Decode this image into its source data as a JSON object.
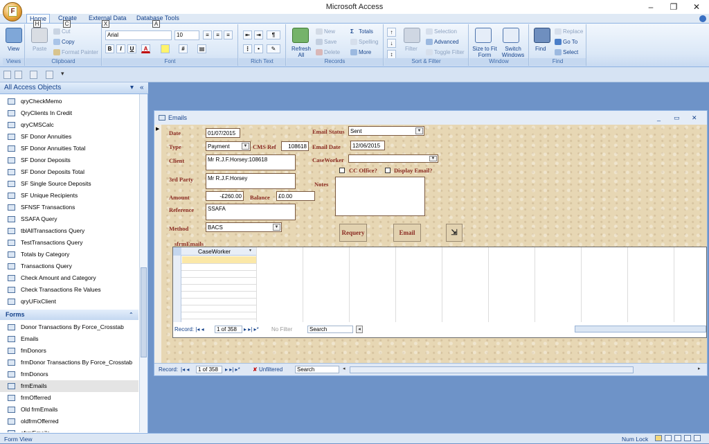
{
  "window": {
    "title": "Microsoft Access",
    "minimize": "–",
    "restore": "❐",
    "close": "✕"
  },
  "tabs": [
    {
      "label": "Home",
      "key": "H"
    },
    {
      "label": "Create",
      "key": "C"
    },
    {
      "label": "External Data",
      "key": "X"
    },
    {
      "label": "Database Tools",
      "key": "A"
    }
  ],
  "ribbon": {
    "views": {
      "view": "View",
      "group": "Views"
    },
    "clipboard": {
      "paste": "Paste",
      "cut": "Cut",
      "copy": "Copy",
      "format_painter": "Format Painter",
      "group": "Clipboard"
    },
    "font": {
      "name": "Arial",
      "size": "10",
      "bold": "B",
      "italic": "I",
      "underline": "U",
      "font_color": "A",
      "group": "Font"
    },
    "rich_text": {
      "group": "Rich Text"
    },
    "records": {
      "refresh": "Refresh All",
      "new": "New",
      "save": "Save",
      "delete": "Delete",
      "totals": "Totals",
      "spelling": "Spelling",
      "more": "More",
      "group": "Records"
    },
    "sort_filter": {
      "filter": "Filter",
      "selection": "Selection",
      "advanced": "Advanced",
      "toggle_filter": "Toggle Filter",
      "group": "Sort & Filter"
    },
    "window": {
      "size_to_fit": "Size to Fit Form",
      "switch_windows": "Switch Windows",
      "group": "Window"
    },
    "find": {
      "find": "Find",
      "replace": "Replace",
      "goto": "Go To",
      "select": "Select",
      "group": "Find"
    }
  },
  "nav": {
    "header": "All Access Objects",
    "queries": [
      "qryCheckMemo",
      "QryClients In Credit",
      "qryCMSCalc",
      "SF Donor Annuities",
      "SF Donor Annuities Total",
      "SF Donor Deposits",
      "SF Donor Deposits Total",
      "SF Single Source Deposits",
      "SF Unique Recipients",
      "SFNSF Transactions",
      "SSAFA Query",
      "tblAllTransactions Query",
      "TestTransactions Query",
      "Totals by Category",
      "Transactions Query",
      "Check Amount and Category",
      "Check Transactions Re Values",
      "qryUFixClient"
    ],
    "forms_header": "Forms",
    "forms": [
      "Donor Transactions By Force_Crosstab",
      "Emails",
      "fmDonors",
      "frmDonor Transactions By Force_Crosstab",
      "frmDonors",
      "frmEmails",
      "frmOfferred",
      "Old frmEmails",
      "oldfrmOfferred",
      "sfrmEmails"
    ]
  },
  "form": {
    "title": "Emails",
    "labels": {
      "date": "Date",
      "type": "Type",
      "cms_ref": "CMS Ref",
      "client": "Client",
      "third_party": "3rd Party",
      "amount": "Amount",
      "balance": "Balance",
      "reference": "Reference",
      "method": "Method",
      "email_status": "Email Status",
      "email_date": "Email Date",
      "caseworker": "CaseWorker",
      "cc_office": "CC Office?",
      "display_email": "Display Email?",
      "notes": "Notes",
      "subform": "sfrmEmails"
    },
    "values": {
      "date": "01/07/2015",
      "type": "Payment",
      "cms_ref": "108618",
      "client": "Mr R.J.F.Horsey:108618",
      "third_party": "Mr R.J.F.Horsey",
      "amount": "-£260.00",
      "balance": "£0.00",
      "reference": "SSAFA",
      "method": "BACS",
      "email_status": "Sent",
      "email_date": "12/06/2015",
      "caseworker": "",
      "notes": ""
    },
    "buttons": {
      "requery": "Requery",
      "email": "Email"
    },
    "subform_grid": {
      "column": "CaseWorker",
      "record_label": "Record:",
      "record_pos": "1 of 358",
      "filter": "No Filter",
      "search": "Search"
    },
    "main_nav": {
      "record_label": "Record:",
      "record_pos": "1 of 358",
      "filter": "Unfiltered",
      "search": "Search"
    }
  },
  "status": {
    "left": "Form View",
    "right": "Num Lock"
  }
}
